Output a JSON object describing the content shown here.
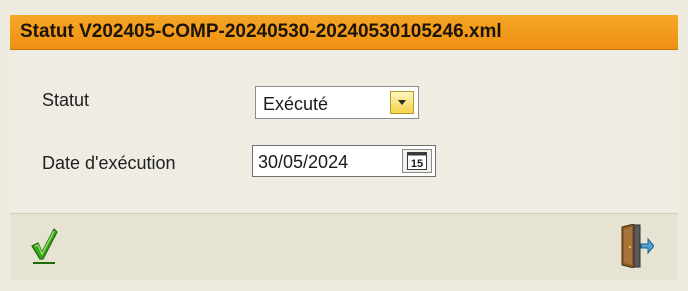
{
  "window": {
    "title": "Statut V202405-COMP-20240530-20240530105246.xml"
  },
  "form": {
    "statut": {
      "label": "Statut",
      "value": "Exécuté",
      "dropdown_icon": "chevron-down-icon"
    },
    "date_execution": {
      "label": "Date d'exécution",
      "value": "30/05/2024",
      "calendar_day": "15",
      "calendar_icon": "calendar-icon"
    }
  },
  "footer": {
    "confirm_icon": "checkmark-icon",
    "exit_icon": "exit-door-icon"
  },
  "colors": {
    "title_bar": "#f29a1a",
    "dialog_background": "#edeade",
    "footer_background": "#e6e3d3",
    "dropdown_button": "#f5d34a",
    "confirm_green": "#3ba41a"
  }
}
